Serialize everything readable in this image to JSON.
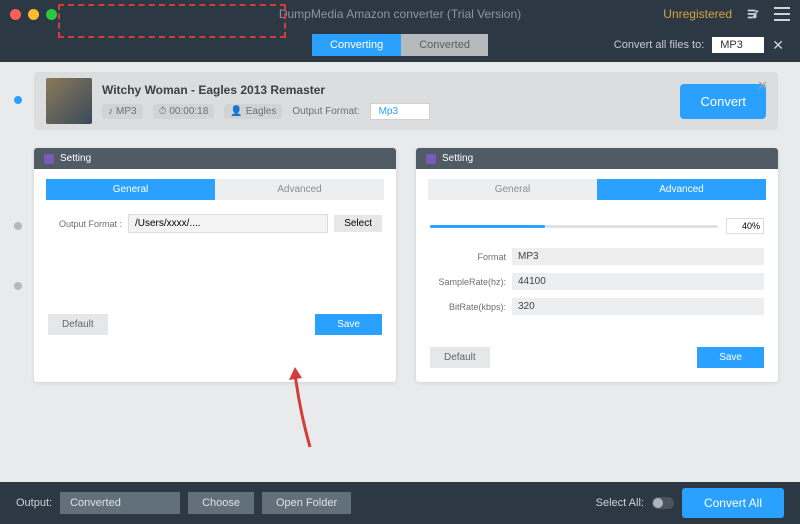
{
  "titlebar": {
    "title": "DumpMedia Amazon converter (Trial Version)",
    "status": "Unregistered"
  },
  "subbar": {
    "tab_converting": "Converting",
    "tab_converted": "Converted",
    "convert_all_label": "Convert all files to:",
    "convert_all_format": "MP3"
  },
  "track": {
    "title": "Witchy Woman - Eagles 2013 Remaster",
    "format_badge": "MP3",
    "duration": "00:00:18",
    "artist": "Eagles",
    "output_format_label": "Output Format:",
    "output_format_value": "Mp3",
    "convert_btn": "Convert"
  },
  "panel_general": {
    "header": "Setting",
    "tab_general": "General",
    "tab_advanced": "Advanced",
    "output_format_label": "Output Format :",
    "output_path": "/Users/xxxx/....",
    "select_btn": "Select",
    "default_btn": "Default",
    "save_btn": "Save"
  },
  "panel_advanced": {
    "header": "Setting",
    "tab_general": "General",
    "tab_advanced": "Advanced",
    "percent": "40%",
    "format_label": "Format",
    "format_value": "MP3",
    "samplerate_label": "SampleRate(hz):",
    "samplerate_value": "44100",
    "bitrate_label": "BitRate(kbps):",
    "bitrate_value": "320",
    "default_btn": "Default",
    "save_btn": "Save"
  },
  "footer": {
    "output_label": "Output:",
    "output_folder": "Converted",
    "choose_btn": "Choose",
    "open_folder_btn": "Open Folder",
    "select_all_label": "Select All:",
    "convert_all_btn": "Convert All"
  }
}
